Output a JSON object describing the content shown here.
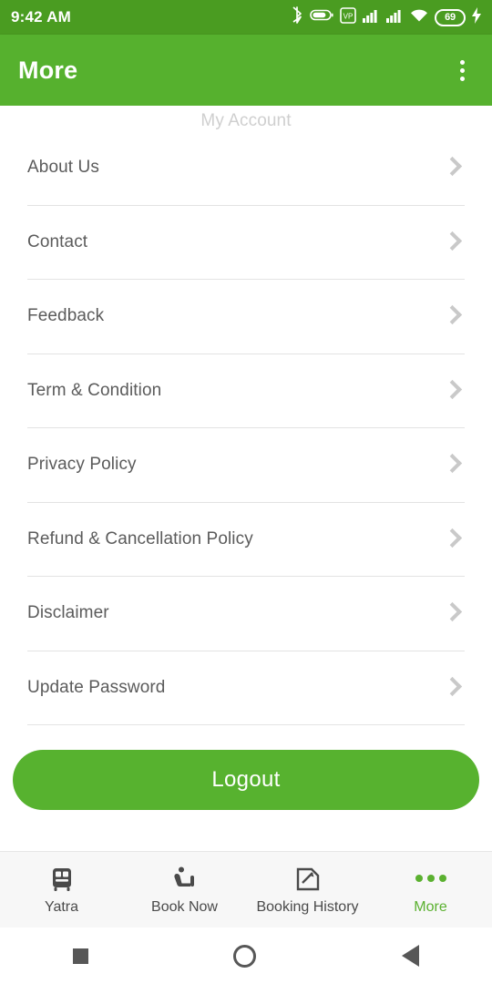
{
  "status_bar": {
    "time": "9:42 AM",
    "battery_percent": "69",
    "icons": [
      "bluetooth-icon",
      "battery-capsule-icon",
      "vpn-key-icon",
      "signal-sim1-icon",
      "signal-sim2-icon",
      "wifi-icon",
      "battery-level-icon",
      "charging-bolt-icon"
    ]
  },
  "app_bar": {
    "title": "More",
    "overflow_icon": "more-vert-icon"
  },
  "colors": {
    "brand_green": "#56b12e",
    "status_bar_green": "#4a9c21",
    "accent_text": "#5bb130",
    "row_text": "#5b5b5b",
    "divider": "#e3e3e3"
  },
  "menu": {
    "clipped_item_label": "My Account",
    "items": [
      {
        "label": "About Us",
        "chevron": "chevron-right-icon"
      },
      {
        "label": "Contact",
        "chevron": "chevron-right-icon"
      },
      {
        "label": "Feedback",
        "chevron": "chevron-right-icon"
      },
      {
        "label": "Term & Condition",
        "chevron": "chevron-right-icon"
      },
      {
        "label": "Privacy Policy",
        "chevron": "chevron-right-icon"
      },
      {
        "label": "Refund & Cancellation Policy",
        "chevron": "chevron-right-icon"
      },
      {
        "label": "Disclaimer",
        "chevron": "chevron-right-icon"
      },
      {
        "label": "Update Password",
        "chevron": "chevron-right-icon"
      }
    ]
  },
  "logout": {
    "label": "Logout"
  },
  "bottom_nav": {
    "items": [
      {
        "label": "Yatra",
        "icon": "bus-icon",
        "active": false
      },
      {
        "label": "Book Now",
        "icon": "seat-icon",
        "active": false
      },
      {
        "label": "Booking History",
        "icon": "booking-history-icon",
        "active": false
      },
      {
        "label": "More",
        "icon": "more-horiz-icon",
        "active": true
      }
    ]
  },
  "system_nav": {
    "items": [
      {
        "name": "recents-square-icon"
      },
      {
        "name": "home-circle-icon"
      },
      {
        "name": "back-triangle-icon"
      }
    ]
  }
}
